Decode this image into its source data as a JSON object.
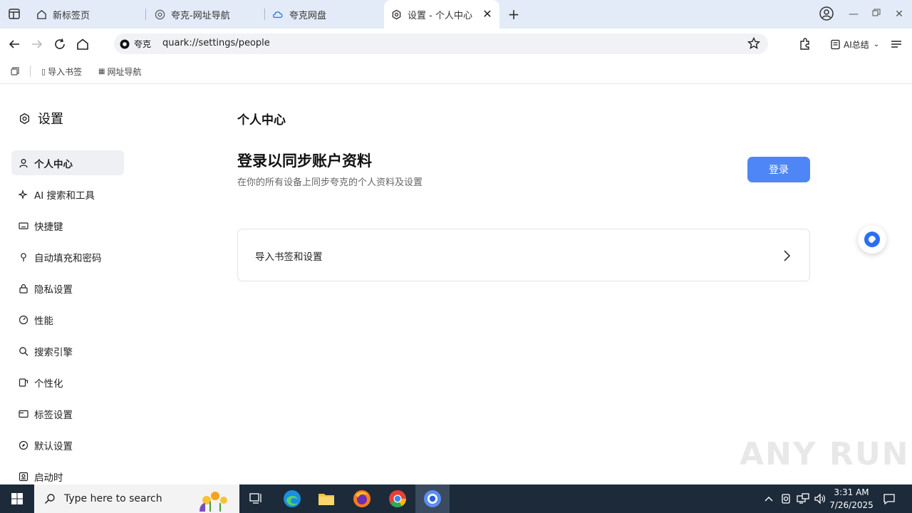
{
  "tabs": [
    {
      "label": "新标签页",
      "icon": "home-icon"
    },
    {
      "label": "夸克-网址导航",
      "icon": "globe-icon"
    },
    {
      "label": "夸克网盘",
      "icon": "cloud-icon"
    },
    {
      "label": "设置 - 个人中心",
      "icon": "gear-icon",
      "active": true
    }
  ],
  "omnibox": {
    "site_chip": "夸克",
    "url": "quark://settings/people"
  },
  "toolbar": {
    "ai_summary": "AI总结"
  },
  "bookmarks": [
    {
      "label": "导入书签"
    },
    {
      "label": "网址导航"
    }
  ],
  "settings": {
    "title": "设置",
    "nav": [
      {
        "label": "个人中心",
        "icon": "person-icon",
        "active": true
      },
      {
        "label": "AI 搜索和工具",
        "icon": "sparkle-icon"
      },
      {
        "label": "快捷键",
        "icon": "keyboard-icon"
      },
      {
        "label": "自动填充和密码",
        "icon": "key-icon"
      },
      {
        "label": "隐私设置",
        "icon": "lock-icon"
      },
      {
        "label": "性能",
        "icon": "gauge-icon"
      },
      {
        "label": "搜索引擎",
        "icon": "search-icon"
      },
      {
        "label": "个性化",
        "icon": "brush-icon"
      },
      {
        "label": "标签设置",
        "icon": "tab-icon"
      },
      {
        "label": "默认设置",
        "icon": "compass-icon"
      },
      {
        "label": "启动时",
        "icon": "power-icon"
      }
    ]
  },
  "main": {
    "heading": "个人中心",
    "sync_title": "登录以同步账户资料",
    "sync_desc": "在你的所有设备上同步夸克的个人资料及设置",
    "login_label": "登录",
    "import_label": "导入书签和设置"
  },
  "watermark": "ANY RUN",
  "taskbar": {
    "search_placeholder": "Type here to search",
    "time": "3:31 AM",
    "date": "7/26/2025"
  },
  "colors": {
    "accent": "#4f86f7",
    "tabstrip": "#e3ebf8",
    "taskbar": "#1c2a3a"
  }
}
